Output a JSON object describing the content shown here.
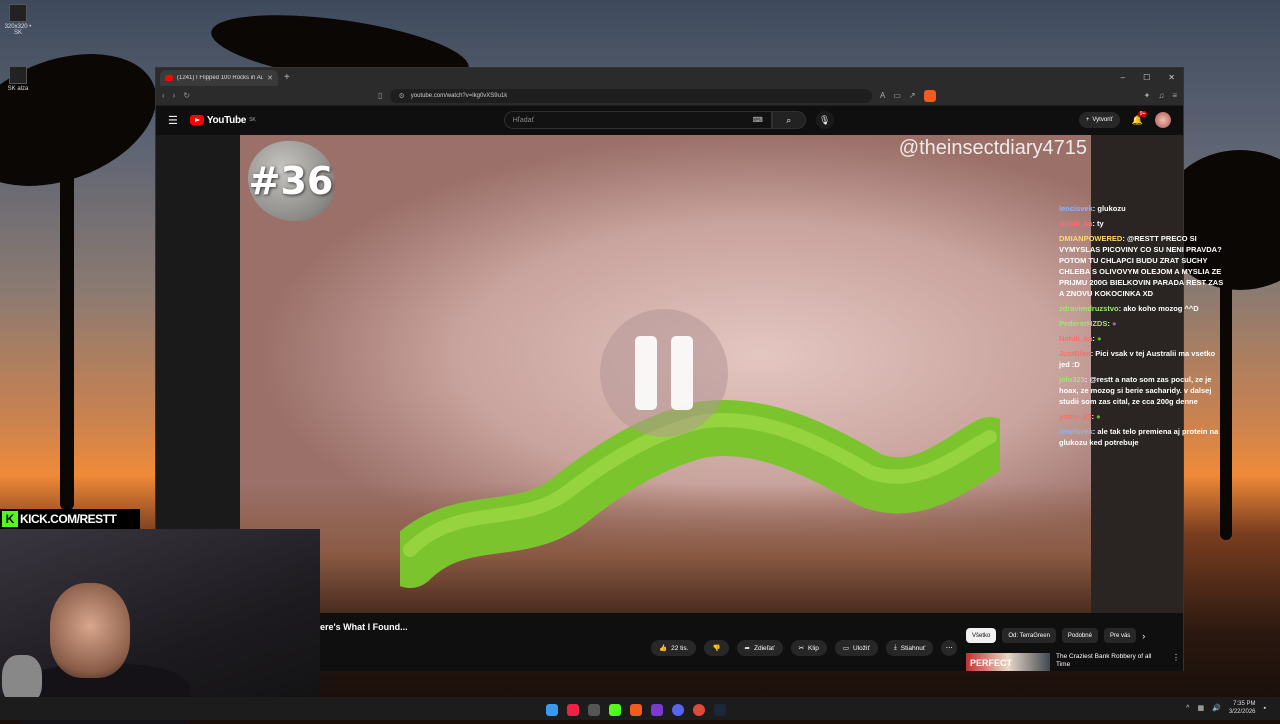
{
  "desktop": {
    "icons": [
      {
        "label": "320x320 • SK"
      },
      {
        "label": "SK alza"
      }
    ]
  },
  "browser": {
    "tab_title": "(1241) I Flipped 100 Rocks in Au",
    "url": "youtube.com/watch?v=lkg0vXS9u1k",
    "window_controls": {
      "min": "–",
      "max": "☐",
      "close": "✕"
    }
  },
  "youtube": {
    "logo_text": "YouTube",
    "logo_region": "SK",
    "search_placeholder": "Hľadať",
    "create_label": "Vytvoriť",
    "notif_count": "9+"
  },
  "video": {
    "rock_number": "#36",
    "watermark": "@theinsectdiary4715",
    "title_partial": "ere's What I Found...",
    "state": "paused"
  },
  "chat": [
    {
      "user": "lencisvek",
      "text": "glukozu",
      "color": "#8ab4f8"
    },
    {
      "user": "Natuli_ka",
      "text": "ty",
      "color": "#ff6b6b"
    },
    {
      "user": "DMIANPOWERED",
      "text": "@RESTT PRECO SI VYMYSLAS PICOVINY CO SU NENI PRAVDA? POTOM TU CHLAPCI BUDU ZRAT SUCHY CHLEBA S OLIVOVYM OLEJOM A MYSLIA ZE PRIJMU 200G BIELKOVIN PARADA REST ZAS A ZNOVU KOKOCINKA XD",
      "color": "#ffd966"
    },
    {
      "user": "zdravimdruzstvo",
      "text": "ako koho mozog ^^D",
      "color": "#9fe870"
    },
    {
      "user": "PedererHZDS",
      "text": "",
      "color": "#9fe870"
    },
    {
      "user": "Natuli_ka",
      "text": "",
      "color": "#ff6b6b"
    },
    {
      "user": "JustBlen",
      "text": "Pici vsak v tej Australii ma vsetko jed :D",
      "color": "#ff6b6b"
    },
    {
      "user": "jolo323",
      "text": "@restt a nato som zas pocul, ze je hoax, ze mozog si berie sacharidy. v dalsej studii som zas cital, ze cca 200g denne",
      "color": "#9fe870"
    },
    {
      "user": "yomo_23",
      "text": "",
      "color": "#ff6b6b"
    },
    {
      "user": "lencisvek",
      "text": "ale tak telo premiena aj protein na glukozu ked potrebuje",
      "color": "#8ab4f8"
    }
  ],
  "actions": {
    "likes": "22 tis.",
    "share": "Zdieľať",
    "clip": "Klip",
    "save": "Uložiť",
    "download": "Stiahnuť"
  },
  "chips": [
    "Všetko",
    "Od: TerraGreen",
    "Podobné",
    "Pre vás"
  ],
  "recommendation": {
    "title": "The Craziest Bank Robbery of all Time",
    "thumb_text": "PERFECT"
  },
  "stream": {
    "kick_url": "KICK.COM/RESTT"
  },
  "taskbar": {
    "time": "7:35 PM",
    "date": "3/22/2026"
  }
}
